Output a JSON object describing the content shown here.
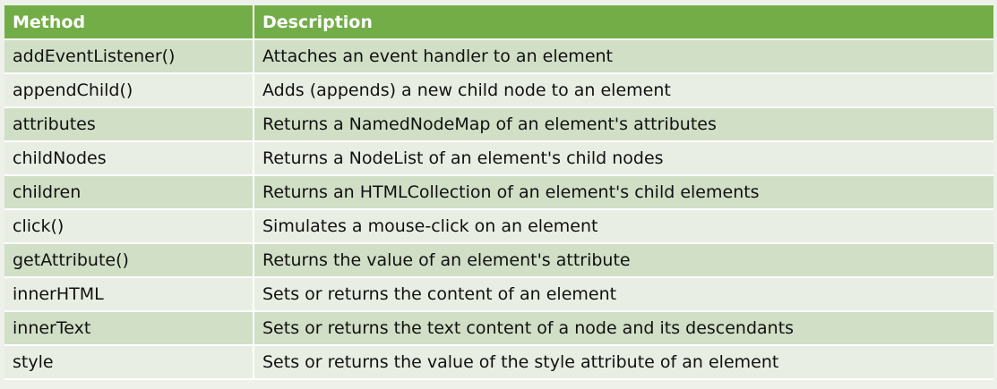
{
  "table": {
    "headers": [
      "Method",
      "Description"
    ],
    "rows": [
      [
        "addEventListener()",
        "Attaches an event handler to an element"
      ],
      [
        "appendChild()",
        "Adds (appends) a new child node to an element"
      ],
      [
        "attributes",
        "Returns a NamedNodeMap of an element's attributes"
      ],
      [
        "childNodes",
        "Returns a NodeList of an element's child nodes"
      ],
      [
        "children",
        "Returns an HTMLCollection of an element's child elements"
      ],
      [
        "click()",
        "Simulates a mouse-click on an element"
      ],
      [
        "getAttribute()",
        "Returns the value of an element's attribute"
      ],
      [
        "innerHTML",
        "Sets or returns the content of an element"
      ],
      [
        "innerText",
        "Sets or returns the text content of a node and its descendants"
      ],
      [
        "style",
        "Sets or returns the value of the style attribute of an element"
      ]
    ]
  },
  "colors": {
    "header_bg": "#72ad47",
    "row_dark": "#d0dfc6",
    "row_light": "#e8eee3"
  }
}
